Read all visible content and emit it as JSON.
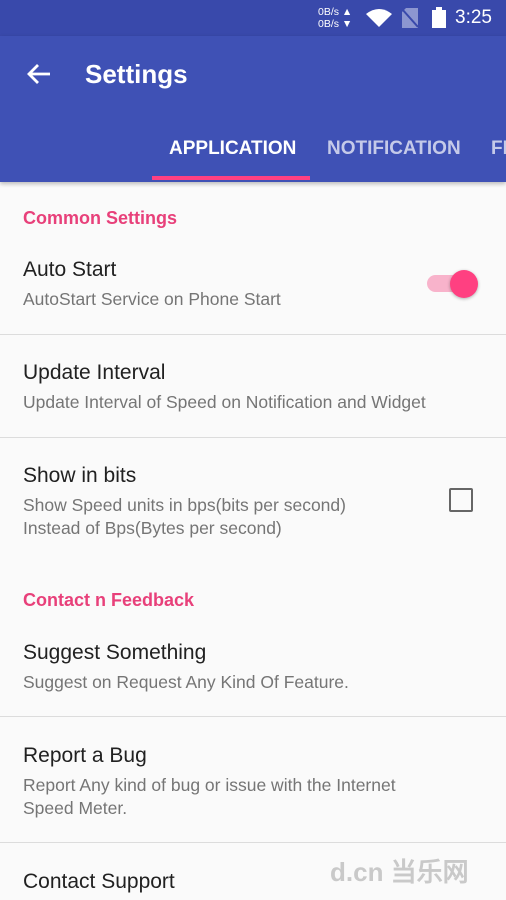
{
  "status_bar": {
    "upload": "0B/s ▲",
    "download": "0B/s ▼",
    "time": "3:25",
    "icons": [
      "wifi-icon",
      "no-sim-icon",
      "battery-icon"
    ]
  },
  "app_bar": {
    "title": "Settings",
    "back_icon": "arrow-left-icon"
  },
  "tabs": [
    {
      "label": "APPLICATION",
      "active": true
    },
    {
      "label": "NOTIFICATION",
      "active": false
    },
    {
      "label": "FL",
      "active": false
    }
  ],
  "colors": {
    "primary": "#3f51b5",
    "status": "#3949ab",
    "accent": "#ff4081",
    "category": "#e8407a"
  },
  "sections": [
    {
      "header": "Common Settings",
      "items": [
        {
          "title": "Auto Start",
          "subtitle": "AutoStart Service on Phone Start",
          "control": "toggle",
          "checked": true
        },
        {
          "title": "Update Interval",
          "subtitle": "Update Interval of Speed on Notification and Widget"
        },
        {
          "title": "Show in bits",
          "subtitle1": "Show Speed units in bps(bits per second)",
          "subtitle2": "Instead of Bps(Bytes per second)",
          "control": "checkbox",
          "checked": false
        }
      ]
    },
    {
      "header": "Contact n Feedback",
      "items": [
        {
          "title": "Suggest Something",
          "subtitle": "Suggest on Request Any Kind Of Feature."
        },
        {
          "title": "Report a Bug",
          "subtitle1": "Report Any kind of bug or issue with the Internet",
          "subtitle2": "Speed Meter."
        },
        {
          "title": "Contact Support"
        }
      ]
    }
  ],
  "watermark": "d.cn 当乐网"
}
